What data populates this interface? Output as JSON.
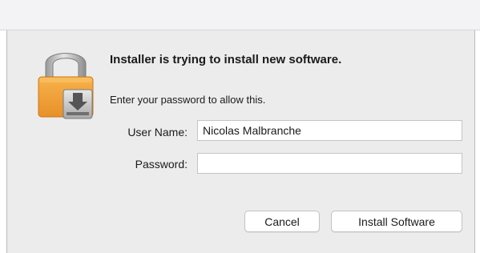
{
  "dialog": {
    "heading": "Installer is trying to install new software.",
    "subtext": "Enter your password to allow this.",
    "icon": "lock-installer-icon"
  },
  "form": {
    "username_label": "User Name:",
    "username_value": "Nicolas Malbranche",
    "password_label": "Password:",
    "password_value": ""
  },
  "buttons": {
    "cancel_label": "Cancel",
    "install_label": "Install Software"
  },
  "colors": {
    "lock_body": "#f0a33a",
    "lock_shackle": "#b8b8b8",
    "dialog_bg": "#ececec"
  }
}
